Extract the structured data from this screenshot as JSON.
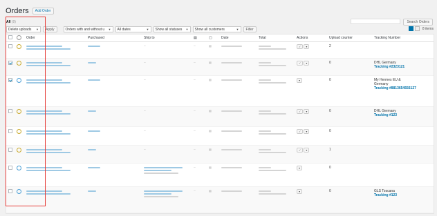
{
  "page": {
    "title": "Orders",
    "add_label": "Add Order"
  },
  "views": {
    "all_label": "All",
    "all_count": "(8)"
  },
  "search": {
    "button_label": "Search Orders"
  },
  "filters": {
    "bulk": "Delete uploads",
    "apply": "Apply",
    "orders_with": "Orders with and without u",
    "dates": "All dates",
    "statuses": "Show all statuses",
    "customers": "Show all customers",
    "filter": "Filter"
  },
  "items_count": "8 items",
  "columns": {
    "order": "Order",
    "purchased": "Purchased",
    "ship_to": "Ship to",
    "date": "Date",
    "total": "Total",
    "actions": "Actions",
    "upload_counter": "Upload counter",
    "tracking": "Tracking Number"
  },
  "rows": [
    {
      "checked": false,
      "status": "hold",
      "counter": "2",
      "track_lines": [],
      "track_link": ""
    },
    {
      "checked": true,
      "status": "hold",
      "counter": "0",
      "track_lines": [
        "DHL Germany"
      ],
      "track_link": "Tracking #2323121"
    },
    {
      "checked": true,
      "status": "proc",
      "counter": "0",
      "track_lines": [
        "My Hermes EU &",
        "Germany"
      ],
      "track_link": "Tracking #8813654556127"
    },
    {
      "checked": false,
      "status": "hold",
      "counter": "0",
      "track_lines": [
        "DHL Germany"
      ],
      "track_link": "Tracking #123"
    },
    {
      "checked": false,
      "status": "hold",
      "counter": "0",
      "track_lines": [],
      "track_link": ""
    },
    {
      "checked": false,
      "status": "hold",
      "counter": "1",
      "track_lines": [],
      "track_link": ""
    },
    {
      "checked": false,
      "status": "proc",
      "counter": "0",
      "track_lines": [],
      "track_link": ""
    },
    {
      "checked": false,
      "status": "proc",
      "counter": "0",
      "track_lines": [
        "GLS Toscana"
      ],
      "track_link": "Tracking #123"
    }
  ],
  "colors": {
    "accent": "#0073aa",
    "highlight": "#e53935"
  }
}
